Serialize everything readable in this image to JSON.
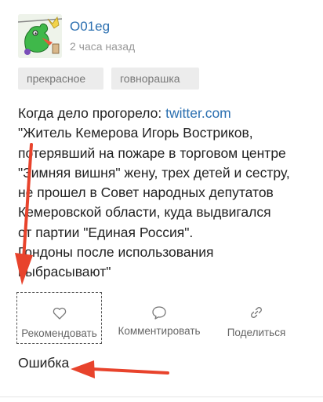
{
  "post": {
    "author": "O01eg",
    "time": "2 часа назад",
    "tags": [
      "прекрасное",
      "говнорашка"
    ],
    "body": {
      "intro": "Когда дело прогорело: ",
      "link": "twitter.com",
      "lines": [
        "\"Житель Кемерова Игорь Востриков,",
        "потерявший на пожаре в торговом центре",
        "\"Зимняя вишня\" жену, трех детей и сестру,",
        "не прошел в Совет народных депутатов",
        "Кемеровской области, куда выдвигался",
        "от партии \"Единая Россия\".",
        "Гондоны после использования",
        "выбрасывают\""
      ]
    },
    "actions": {
      "recommend": "Рекомендовать",
      "comment": "Комментировать",
      "share": "Поделиться"
    },
    "error": "Ошибка"
  },
  "colors": {
    "link": "#2b6fb0",
    "arrow": "#e8432c",
    "tag_bg": "#ececec"
  },
  "icons": {
    "recommend": "heart-icon",
    "comment": "speech-bubble-icon",
    "share": "chain-link-icon"
  }
}
